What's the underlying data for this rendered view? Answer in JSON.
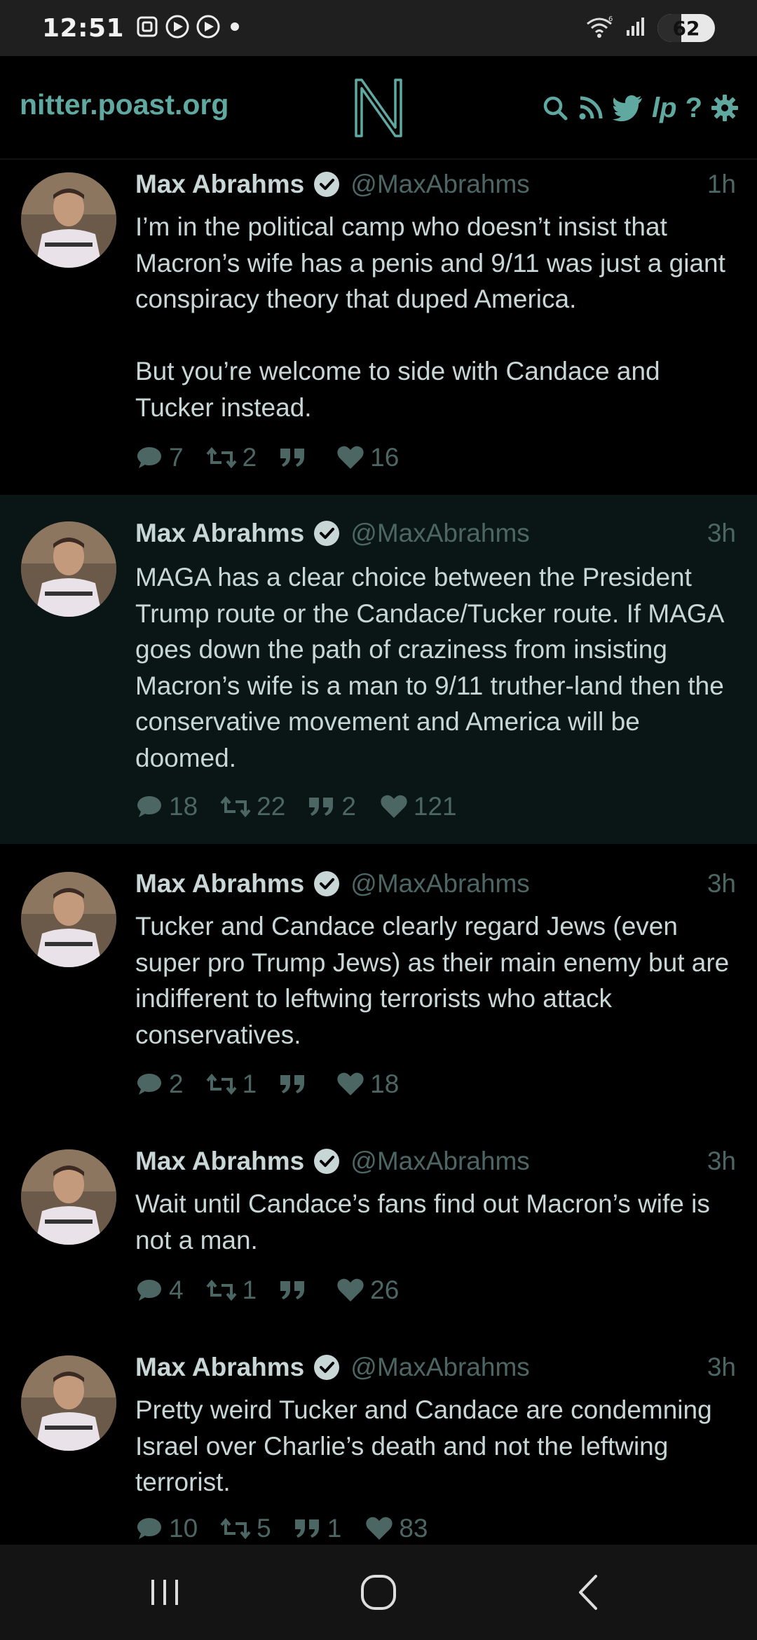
{
  "status_bar": {
    "time": "12:51",
    "battery": "62",
    "icons": [
      "screenshot-icon",
      "play-circle-icon",
      "play-circle-icon",
      "notification-dot-icon",
      "wifi-icon",
      "signal-icon"
    ]
  },
  "navbar": {
    "site": "nitter.poast.org",
    "logo": "N",
    "icons": [
      "search-icon",
      "rss-icon",
      "twitter-icon",
      "liberapay-icon",
      "help-icon",
      "settings-icon"
    ]
  },
  "tweets": [
    {
      "author": "Max Abrahms",
      "handle": "@MaxAbrahms",
      "time": "1h",
      "text": "I’m in the political camp who doesn’t insist that Macron’s wife has a penis and 9/11 was just a giant conspiracy theory that duped America.\n\nBut you’re welcome to side with Candace and Tucker instead.",
      "replies": "7",
      "retweets": "2",
      "quotes": "",
      "likes": "16"
    },
    {
      "author": "Max Abrahms",
      "handle": "@MaxAbrahms",
      "time": "3h",
      "text": "MAGA has a clear choice between the President Trump route or the Candace/Tucker route. If MAGA goes down the path of craziness from insisting Macron’s wife is a man to 9/11 truther-land then the conservative movement and America will be doomed.",
      "replies": "18",
      "retweets": "22",
      "quotes": "2",
      "likes": "121"
    },
    {
      "author": "Max Abrahms",
      "handle": "@MaxAbrahms",
      "time": "3h",
      "text": "Tucker and Candace clearly regard Jews (even super pro Trump Jews) as their main enemy but are indifferent to leftwing terrorists who attack conservatives.",
      "replies": "2",
      "retweets": "1",
      "quotes": "",
      "likes": "18"
    },
    {
      "author": "Max Abrahms",
      "handle": "@MaxAbrahms",
      "time": "3h",
      "text": "Wait until Candace’s fans find out Macron’s wife is not a man.",
      "replies": "4",
      "retweets": "1",
      "quotes": "",
      "likes": "26"
    },
    {
      "author": "Max Abrahms",
      "handle": "@MaxAbrahms",
      "time": "3h",
      "text": "Pretty weird Tucker and Candace are condemning Israel over Charlie’s death and not the leftwing terrorist.",
      "replies": "10",
      "retweets": "5",
      "quotes": "1",
      "likes": "83"
    }
  ],
  "system_nav": [
    "recent-apps-icon",
    "home-icon",
    "back-icon"
  ],
  "colors": {
    "accent": "#5fa9a0",
    "muted": "#4c6664",
    "text": "#c8d6d6",
    "highlight_bg": "#0a1616"
  }
}
